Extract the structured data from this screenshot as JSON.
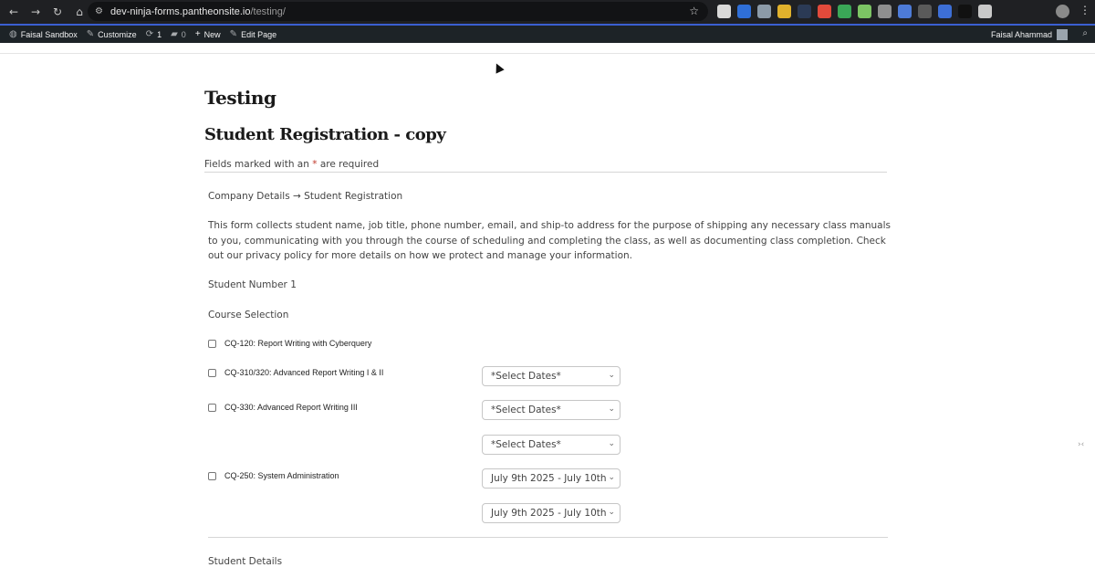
{
  "browser": {
    "url_host": "dev-ninja-forms.pantheonsite.io",
    "url_path": "/testing/",
    "extensions": [
      "#d9d9d9",
      "#2f6fd8",
      "#8c9aa8",
      "#e1b12c",
      "#2b3a55",
      "#e24a3b",
      "#3aa757",
      "#7cc464",
      "#8f8f8f",
      "#4d7bd8",
      "#5a5a5a",
      "#3d6fd6",
      "#111111",
      "#c9c9c9"
    ]
  },
  "adminbar": {
    "site": "Faisal Sandbox",
    "customize": "Customize",
    "updates": "1",
    "comments": "0",
    "new": "New",
    "edit": "Edit Page",
    "user": "Faisal Ahammad"
  },
  "page": {
    "title": "Testing",
    "form_title": "Student Registration - copy",
    "required_prefix": "Fields marked with an ",
    "required_star": "*",
    "required_suffix": " are required",
    "breadcrumb": "Company Details → Student Registration",
    "description": "This form collects student name, job title, phone number, email, and ship-to address for the purpose of shipping any necessary class manuals to you, communicating with you through the course of scheduling and completing the class, as well as documenting class completion. Check out our privacy policy for more details on how we protect and manage your information.",
    "student_number": "Student Number 1",
    "course_selection": "Course Selection",
    "courses": [
      "CQ-120: Report Writing with Cyberquery",
      "CQ-310/320: Advanced Report Writing I & II",
      "CQ-330: Advanced Report Writing III",
      "CQ-250: System Administration"
    ],
    "selects": [
      "*Select Dates*",
      "*Select Dates*",
      "*Select Dates*",
      "July 9th 2025 - July 10th",
      "July 9th 2025 - July 10th"
    ],
    "student_details": "Student Details"
  }
}
